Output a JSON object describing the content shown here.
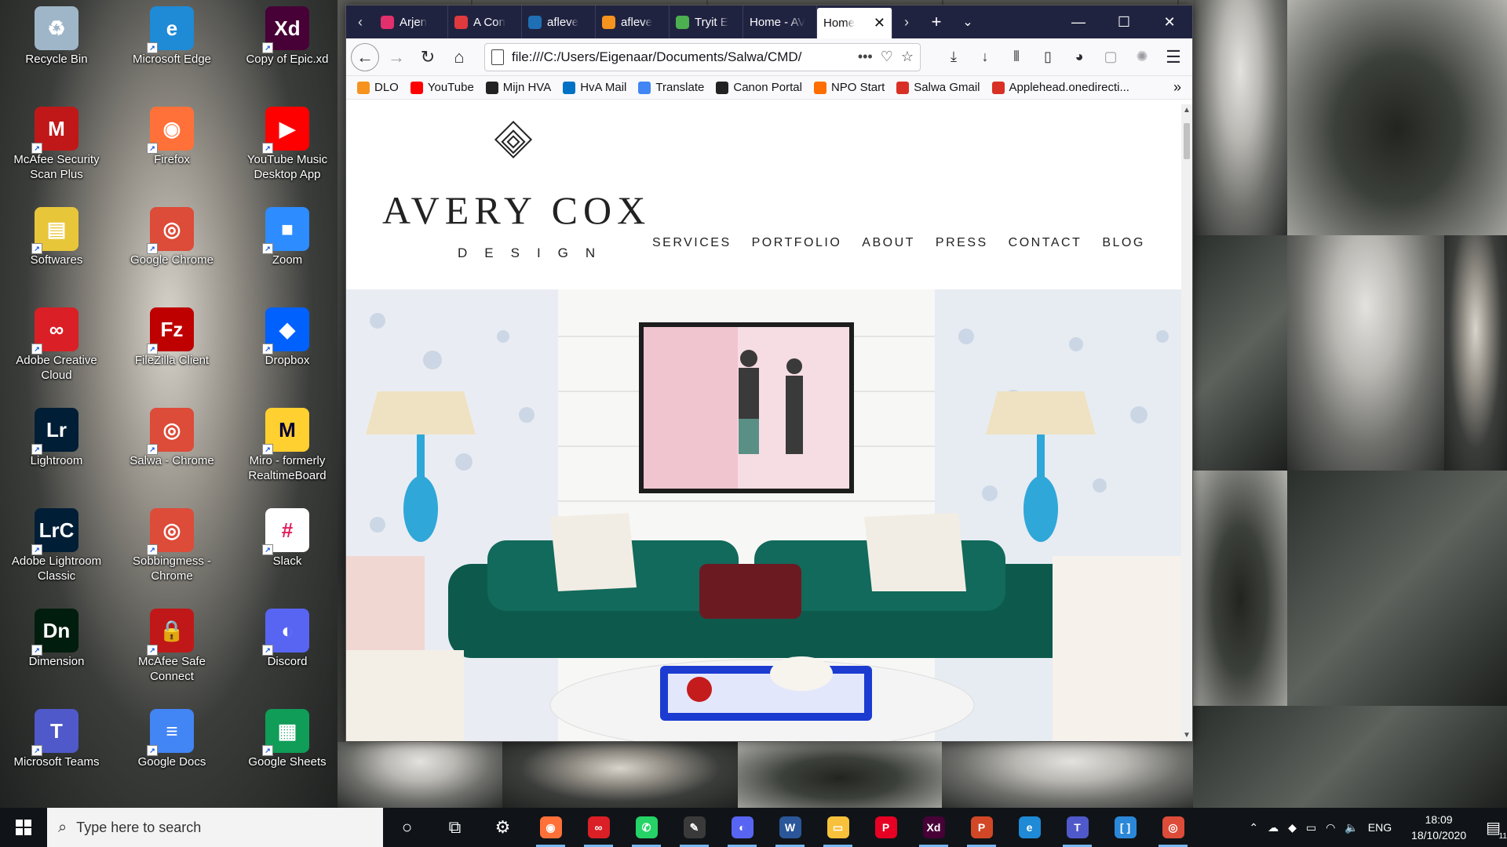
{
  "desktop": {
    "icons": [
      {
        "label": "Recycle Bin",
        "glyph": "♻",
        "color": "#9fb6c8"
      },
      {
        "label": "Microsoft Edge",
        "glyph": "e",
        "color": "#1f8ad6"
      },
      {
        "label": "Copy of Epic.xd",
        "glyph": "Xd",
        "color": "#470137"
      },
      {
        "label": "McAfee Security Scan Plus",
        "glyph": "M",
        "color": "#c01818"
      },
      {
        "label": "Firefox",
        "glyph": "◉",
        "color": "#ff7139"
      },
      {
        "label": "YouTube Music Desktop App",
        "glyph": "▶",
        "color": "#ff0000"
      },
      {
        "label": "Softwares",
        "glyph": "▤",
        "color": "#e8c63a"
      },
      {
        "label": "Google Chrome",
        "glyph": "◎",
        "color": "#dd4b39"
      },
      {
        "label": "Zoom",
        "glyph": "■",
        "color": "#2d8cff"
      },
      {
        "label": "Adobe Creative Cloud",
        "glyph": "∞",
        "color": "#da1f26"
      },
      {
        "label": "FileZilla Client",
        "glyph": "Fz",
        "color": "#bf0000"
      },
      {
        "label": "Dropbox",
        "glyph": "◆",
        "color": "#0061ff"
      },
      {
        "label": "Lightroom",
        "glyph": "Lr",
        "color": "#001e36"
      },
      {
        "label": "Salwa - Chrome",
        "glyph": "◎",
        "color": "#dd4b39"
      },
      {
        "label": "Miro - formerly RealtimeBoard",
        "glyph": "M",
        "color": "#ffd02f"
      },
      {
        "label": "Adobe Lightroom Classic",
        "glyph": "LrC",
        "color": "#001e36"
      },
      {
        "label": "Sobbingmess - Chrome",
        "glyph": "◎",
        "color": "#dd4b39"
      },
      {
        "label": "Slack",
        "glyph": "#",
        "color": "#ffffff"
      },
      {
        "label": "Dimension",
        "glyph": "Dn",
        "color": "#001d0d"
      },
      {
        "label": "McAfee Safe Connect",
        "glyph": "🔒",
        "color": "#c01818"
      },
      {
        "label": "Discord",
        "glyph": "◐",
        "color": "#5865f2"
      },
      {
        "label": "Microsoft Teams",
        "glyph": "T",
        "color": "#5059c9"
      },
      {
        "label": "Google Docs",
        "glyph": "≡",
        "color": "#4285f4"
      },
      {
        "label": "Google Sheets",
        "glyph": "▦",
        "color": "#0f9d58"
      }
    ]
  },
  "browser": {
    "tabs": [
      {
        "title": "Arjen",
        "color": "#e1306c"
      },
      {
        "title": "A Con",
        "color": "#e03a3e"
      },
      {
        "title": "afleve",
        "color": "#1f6fb5"
      },
      {
        "title": "afleve",
        "color": "#f6921e"
      },
      {
        "title": "Tryit E",
        "color": "#4caf50"
      },
      {
        "title": "Home - AV",
        "color": "#202340"
      },
      {
        "title": "Home",
        "color": "#ffffff"
      }
    ],
    "url": "file:///C:/Users/Eigenaar/Documents/Salwa/CMD/",
    "bookmarks": [
      {
        "label": "DLO",
        "color": "#f6921e"
      },
      {
        "label": "YouTube",
        "color": "#ff0000"
      },
      {
        "label": "Mijn HVA",
        "color": "#222222"
      },
      {
        "label": "HvA Mail",
        "color": "#0072c6"
      },
      {
        "label": "Translate",
        "color": "#4285f4"
      },
      {
        "label": "Canon Portal",
        "color": "#222222"
      },
      {
        "label": "NPO Start",
        "color": "#ff6d00"
      },
      {
        "label": "Salwa Gmail",
        "color": "#d93025"
      },
      {
        "label": "Applehead.onedirecti...",
        "color": "#d93025"
      }
    ]
  },
  "site": {
    "brand": "AVERY COX",
    "brand_sub": "DESIGN",
    "nav": [
      "SERVICES",
      "PORTFOLIO",
      "ABOUT",
      "PRESS",
      "CONTACT",
      "BLOG"
    ]
  },
  "taskbar": {
    "search_placeholder": "Type here to search",
    "apps": [
      {
        "name": "cortana",
        "glyph": "○",
        "color": "transparent"
      },
      {
        "name": "task-view",
        "glyph": "⧉",
        "color": "transparent"
      },
      {
        "name": "settings",
        "glyph": "⚙",
        "color": "transparent"
      },
      {
        "name": "firefox",
        "glyph": "◉",
        "color": "#ff7139"
      },
      {
        "name": "creative-cloud",
        "glyph": "∞",
        "color": "#da1f26"
      },
      {
        "name": "whatsapp",
        "glyph": "✆",
        "color": "#25d366"
      },
      {
        "name": "notepad",
        "glyph": "✎",
        "color": "#3a3a3a"
      },
      {
        "name": "discord",
        "glyph": "◐",
        "color": "#5865f2"
      },
      {
        "name": "word",
        "glyph": "W",
        "color": "#2b579a"
      },
      {
        "name": "file-explorer",
        "glyph": "▭",
        "color": "#f8c13b"
      },
      {
        "name": "pinterest",
        "glyph": "P",
        "color": "#e60023"
      },
      {
        "name": "xd",
        "glyph": "Xd",
        "color": "#470137"
      },
      {
        "name": "powerpoint",
        "glyph": "P",
        "color": "#d24726"
      },
      {
        "name": "edge",
        "glyph": "e",
        "color": "#1f8ad6"
      },
      {
        "name": "teams",
        "glyph": "T",
        "color": "#5059c9"
      },
      {
        "name": "app-bracket",
        "glyph": "[ ]",
        "color": "#2b88d8"
      },
      {
        "name": "chrome",
        "glyph": "◎",
        "color": "#dd4b39"
      }
    ],
    "language": "ENG",
    "time": "18:09",
    "date": "18/10/2020",
    "notifications": "11"
  }
}
